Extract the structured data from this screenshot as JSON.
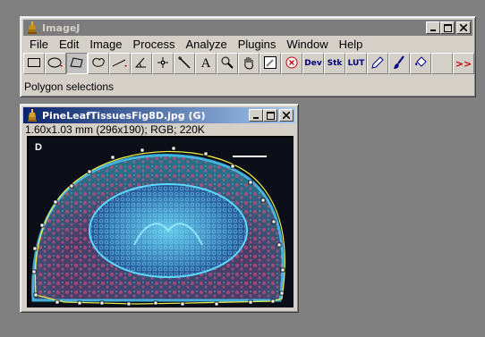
{
  "main_window": {
    "title": "ImageJ",
    "menus": [
      "File",
      "Edit",
      "Image",
      "Process",
      "Analyze",
      "Plugins",
      "Window",
      "Help"
    ],
    "tools": [
      {
        "name": "rectangle-tool-icon",
        "label": ""
      },
      {
        "name": "oval-tool-icon",
        "label": ""
      },
      {
        "name": "polygon-tool-icon",
        "label": ""
      },
      {
        "name": "freehand-tool-icon",
        "label": ""
      },
      {
        "name": "line-tool-icon",
        "label": ""
      },
      {
        "name": "angle-tool-icon",
        "label": ""
      },
      {
        "name": "point-tool-icon",
        "label": ""
      },
      {
        "name": "wand-tool-icon",
        "label": ""
      },
      {
        "name": "text-tool-icon",
        "label": "A"
      },
      {
        "name": "magnifier-tool-icon",
        "label": ""
      },
      {
        "name": "hand-tool-icon",
        "label": ""
      },
      {
        "name": "color-picker-tool-icon",
        "label": ""
      },
      {
        "name": "stop-tool-icon",
        "label": ""
      },
      {
        "name": "developer-menu-icon",
        "label": "Dev"
      },
      {
        "name": "stacks-menu-icon",
        "label": "Stk"
      },
      {
        "name": "lut-menu-icon",
        "label": "LUT"
      },
      {
        "name": "pencil-tool-icon",
        "label": ""
      },
      {
        "name": "brush-tool-icon",
        "label": ""
      },
      {
        "name": "flood-fill-tool-icon",
        "label": ""
      },
      {
        "name": "empty-tool-slot",
        "label": ""
      },
      {
        "name": "more-tools-icon",
        "label": ">>"
      }
    ],
    "selected_tool": "polygon-tool-icon",
    "status": "Polygon selections"
  },
  "image_window": {
    "title": "PineLeafTissuesFig8D.jpg (G)",
    "info": "1.60x1.03 mm (296x190); RGB; 220K",
    "panel_label": "D"
  },
  "colors": {
    "active_title_start": "#0a246a",
    "active_title_end": "#a6caf0",
    "inactive_title": "#808080",
    "selection_outline": "#e8e84a",
    "window_face": "#d4d0c8",
    "desktop": "#808080"
  }
}
